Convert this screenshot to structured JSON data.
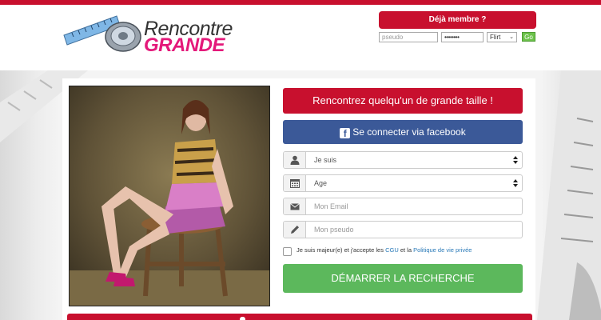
{
  "header": {
    "logo": {
      "word1": "Rencontre",
      "word2": "GRANDE"
    },
    "login": {
      "member_button": "Déjà membre ?",
      "pseudo_placeholder": "pseudo",
      "password_mask": "••••••••",
      "mode_value": "Flirt",
      "go_label": "Go"
    }
  },
  "main": {
    "cta_label": "Rencontrez quelqu'un de grande taille !",
    "facebook_label": "Se connecter via facebook",
    "facebook_icon": "facebook-f",
    "form": {
      "gender_value": "Je suis",
      "age_value": "Age",
      "email_placeholder": "Mon Email",
      "pseudo_placeholder": "Mon pseudo"
    },
    "cgu": {
      "prefix": "Je suis majeur(e) et j'accepte les ",
      "cgu_link": "CGU",
      "middle": " et la ",
      "privacy_link": "Politique de vie privée"
    },
    "start_label": "DÉMARRER LA RECHERCHE"
  },
  "colors": {
    "brand_red": "#c8102e",
    "logo_pink": "#e4197a",
    "facebook_blue": "#3b5998",
    "action_green": "#5cb85c",
    "go_green": "#6cc24a"
  }
}
